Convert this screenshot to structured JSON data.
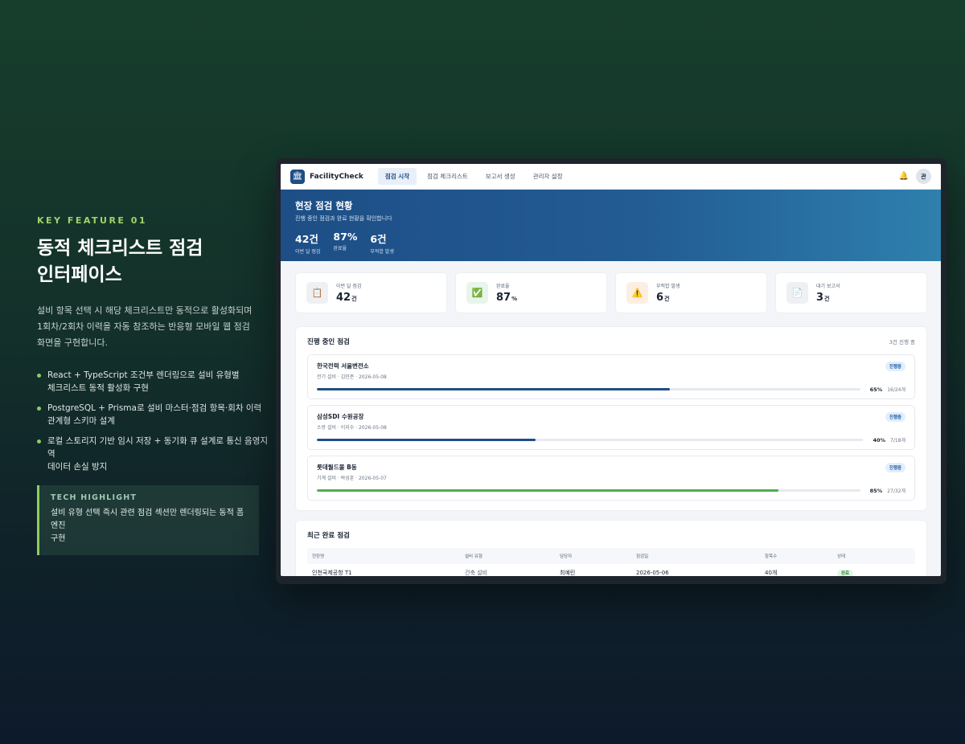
{
  "left": {
    "kicker": "KEY FEATURE 01",
    "headline_line1": "동적 체크리스트 점검",
    "headline_line2": "인터페이스",
    "desc_line1": "설비 항목 선택 시 해당 체크리스트만 동적으로 활성화되며",
    "desc_line2": "1회차/2회차 이력을 자동 참조하는 반응형 모바일 웹 점검",
    "desc_line3": "화면을 구현합니다.",
    "bullets": [
      {
        "line1": "React + TypeScript 조건부 렌더링으로 설비 유형별",
        "line2": "체크리스트 동적 활성화 구현"
      },
      {
        "line1": "PostgreSQL + Prisma로 설비 마스터·점검 항목·회차 이력",
        "line2": "관계형 스키마 설계"
      },
      {
        "line1": "로컬 스토리지 기반 임시 저장 + 동기화 큐 설계로 통신 음영지역",
        "line2": "데이터 손실 방지"
      }
    ],
    "highlight": {
      "title": "TECH HIGHLIGHT",
      "line1": "설비 유형 선택 즉시 관련 점검 섹션만 렌더링되는 동적 폼 엔진",
      "line2": "구현"
    }
  },
  "app": {
    "logo_icon": "building-icon",
    "brand": "FacilityCheck",
    "nav": [
      "점검 시작",
      "점검 체크리스트",
      "보고서 생성",
      "관리자 설정"
    ],
    "active_nav": 0,
    "avatar": "관",
    "banner": {
      "title": "현장 점검 현황",
      "subtitle": "진행 중인 점검과 완료 현황을 확인합니다",
      "stats": [
        {
          "value": "42건",
          "label": "이번 달 점검"
        },
        {
          "value": "87%",
          "label": "완료율"
        },
        {
          "value": "6건",
          "label": "부적합 발생"
        }
      ]
    },
    "cards": [
      {
        "label": "이번 달 점검",
        "value": "42",
        "unit": "건",
        "icon": "📋",
        "icon_bg": "#eef0f3"
      },
      {
        "label": "완료율",
        "value": "87",
        "unit": "%",
        "icon": "✅",
        "icon_bg": "#e7f5ea"
      },
      {
        "label": "부적합 발생",
        "value": "6",
        "unit": "건",
        "icon": "⚠️",
        "icon_bg": "#fdeee2"
      },
      {
        "label": "대기 보고서",
        "value": "3",
        "unit": "건",
        "icon": "📄",
        "icon_bg": "#eef0f3"
      }
    ],
    "in_progress": {
      "title": "진행 중인 점검",
      "count": "3건 진행 중",
      "sites": [
        {
          "name": "한국전력 서울변전소",
          "meta": "전기 설비 · 김민준 · 2026-05-08",
          "status": "진행중",
          "progress": 0.65,
          "pct": "65%",
          "items": "16/24개",
          "color": "#1e4e86"
        },
        {
          "name": "삼성SDI 수원공장",
          "meta": "소방 설비 · 이지수 · 2026-05-08",
          "status": "진행중",
          "progress": 0.4,
          "pct": "40%",
          "items": "7/18개",
          "color": "#1e4e86"
        },
        {
          "name": "롯데월드몰 B동",
          "meta": "기계 설비 · 박성훈 · 2026-05-07",
          "status": "진행중",
          "progress": 0.85,
          "pct": "85%",
          "items": "27/32개",
          "color": "#4caf50"
        }
      ]
    },
    "completed": {
      "title": "최근 완료 점검",
      "columns": [
        "현장명",
        "설비 유형",
        "담당자",
        "점검일",
        "항목수",
        "상태"
      ],
      "rows": [
        [
          "인천국제공항 T1",
          "건축 설비",
          "최예린",
          "2026-05-06",
          "40개",
          "완료"
        ]
      ]
    },
    "colors": {
      "primary": "#1e4e86",
      "accent_green": "#8ccf5c",
      "progress_green": "#4caf50"
    }
  }
}
